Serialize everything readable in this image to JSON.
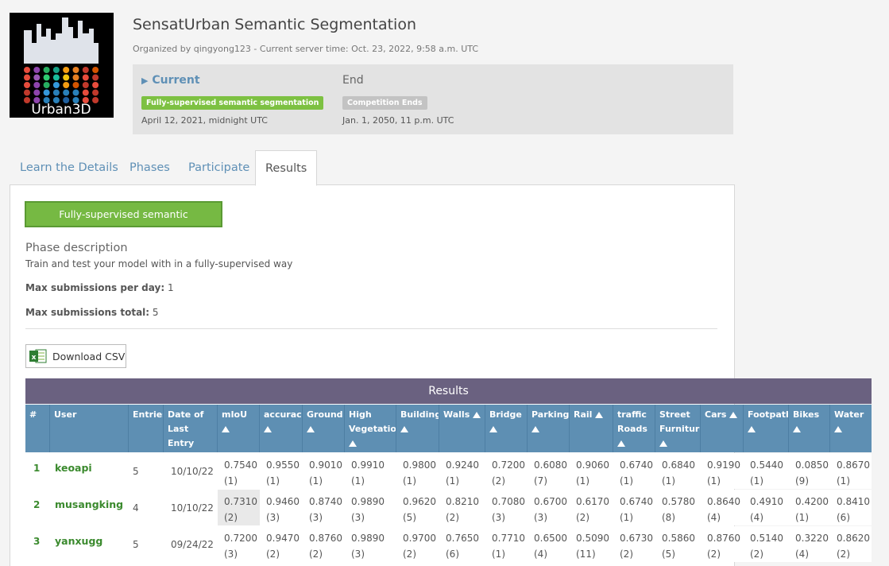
{
  "logo": {
    "text": "Urban3D"
  },
  "competition": {
    "title": "SensatUrban Semantic Segmentation",
    "organizer_line": "Organized by qingyong123 - Current server time: Oct. 23, 2022, 9:58 a.m. UTC"
  },
  "phases": [
    {
      "title": "Current",
      "badge": "Fully-supervised semantic segmentation",
      "date": "April 12, 2021, midnight UTC"
    },
    {
      "title": "End",
      "badge": "Competition Ends",
      "date": "Jan. 1, 2050, 11 p.m. UTC"
    }
  ],
  "tabs": [
    "Learn the Details",
    "Phases",
    "Participate",
    "Results"
  ],
  "active_tab": "Results",
  "results": {
    "phase_button": "Fully-supervised semantic segmentation",
    "description_heading": "Phase description",
    "description_text": "Train and test your model with in a fully-supervised way",
    "max_per_day_label": "Max submissions per day:",
    "max_per_day_value": "1",
    "max_total_label": "Max submissions total:",
    "max_total_value": "5",
    "download_label": "Download CSV",
    "table_title": "Results",
    "columns": [
      "#",
      "User",
      "Entries",
      "Date of Last Entry",
      "mIoU",
      "accuracy",
      "Ground",
      "High Vegetation",
      "Buildings",
      "Walls",
      "Bridge",
      "Parking",
      "Rail",
      "traffic Roads",
      "Street Furniture",
      "Cars",
      "Footpath",
      "Bikes",
      "Water"
    ],
    "rows": [
      {
        "rank": "1",
        "user": "keoapi",
        "entries": "5",
        "date": "10/10/22",
        "scores": [
          [
            "0.7540",
            "(1)"
          ],
          [
            "0.9550",
            "(1)"
          ],
          [
            "0.9010",
            "(1)"
          ],
          [
            "0.9910",
            "(1)"
          ],
          [
            "0.9800",
            "(1)"
          ],
          [
            "0.9240",
            "(1)"
          ],
          [
            "0.7200",
            "(2)"
          ],
          [
            "0.6080",
            "(7)"
          ],
          [
            "0.9060",
            "(1)"
          ],
          [
            "0.6740",
            "(1)"
          ],
          [
            "0.6840",
            "(1)"
          ],
          [
            "0.9190",
            "(1)"
          ],
          [
            "0.5440",
            "(1)"
          ],
          [
            "0.0850",
            "(9)"
          ],
          [
            "0.8670",
            "(1)"
          ]
        ]
      },
      {
        "rank": "2",
        "user": "musangking",
        "entries": "4",
        "date": "10/10/22",
        "scores": [
          [
            "0.7310",
            "(2)"
          ],
          [
            "0.9460",
            "(3)"
          ],
          [
            "0.8740",
            "(3)"
          ],
          [
            "0.9890",
            "(3)"
          ],
          [
            "0.9620",
            "(5)"
          ],
          [
            "0.8210",
            "(2)"
          ],
          [
            "0.7080",
            "(3)"
          ],
          [
            "0.6700",
            "(3)"
          ],
          [
            "0.6170",
            "(2)"
          ],
          [
            "0.6740",
            "(1)"
          ],
          [
            "0.5780",
            "(8)"
          ],
          [
            "0.8640",
            "(4)"
          ],
          [
            "0.4910",
            "(4)"
          ],
          [
            "0.4200",
            "(1)"
          ],
          [
            "0.8410",
            "(6)"
          ]
        ]
      },
      {
        "rank": "3",
        "user": "yanxugg",
        "entries": "5",
        "date": "09/24/22",
        "scores": [
          [
            "0.7200",
            "(3)"
          ],
          [
            "0.9470",
            "(2)"
          ],
          [
            "0.8760",
            "(2)"
          ],
          [
            "0.9890",
            "(3)"
          ],
          [
            "0.9700",
            "(2)"
          ],
          [
            "0.7650",
            "(6)"
          ],
          [
            "0.7710",
            "(1)"
          ],
          [
            "0.6500",
            "(4)"
          ],
          [
            "0.5090",
            "(11)"
          ],
          [
            "0.6730",
            "(2)"
          ],
          [
            "0.5860",
            "(5)"
          ],
          [
            "0.8760",
            "(2)"
          ],
          [
            "0.5140",
            "(2)"
          ],
          [
            "0.3220",
            "(4)"
          ],
          [
            "0.8620",
            "(2)"
          ]
        ]
      }
    ]
  }
}
